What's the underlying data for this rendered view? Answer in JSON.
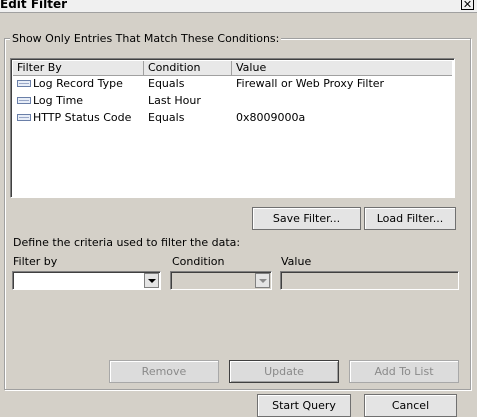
{
  "window": {
    "title": "Edit Filter",
    "close_glyph": "✕"
  },
  "group": {
    "legend": "Show Only Entries That Match These Conditions:"
  },
  "list": {
    "columns": [
      "Filter By",
      "Condition",
      "Value"
    ],
    "rows": [
      {
        "filter_by": "Log Record Type",
        "condition": "Equals",
        "value": "Firewall or Web Proxy Filter",
        "icon": "filter-rule-icon"
      },
      {
        "filter_by": "Log Time",
        "condition": "Last Hour",
        "value": "",
        "icon": "filter-rule-icon"
      },
      {
        "filter_by": "HTTP Status Code",
        "condition": "Equals",
        "value": "0x8009000a",
        "icon": "filter-rule-icon"
      }
    ]
  },
  "buttons": {
    "save_filter": "Save Filter...",
    "load_filter": "Load Filter...",
    "remove": "Remove",
    "update": "Update",
    "add_to_list": "Add To List",
    "start_query": "Start Query",
    "cancel": "Cancel"
  },
  "criteria": {
    "instruction": "Define the criteria used to filter the data:",
    "filter_by_label": "Filter by",
    "condition_label": "Condition",
    "value_label": "Value",
    "filter_by_value": "",
    "condition_value": "",
    "value_value": ""
  }
}
